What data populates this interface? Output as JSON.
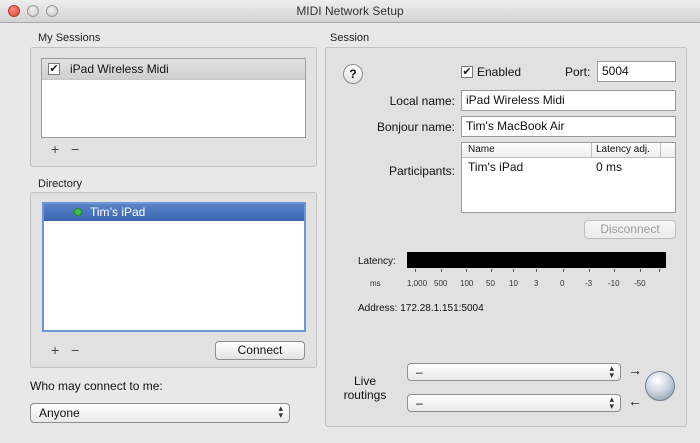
{
  "window": {
    "title": "MIDI Network Setup"
  },
  "my_sessions": {
    "label": "My Sessions",
    "items": [
      {
        "label": "iPad Wireless Midi",
        "checked": true,
        "mark": "✔"
      }
    ],
    "add": "+",
    "remove": "−"
  },
  "directory": {
    "label": "Directory",
    "items": [
      {
        "label": "Tim’s iPad",
        "status_color": "#3cc43c"
      }
    ],
    "add": "+",
    "remove": "−",
    "connect_label": "Connect"
  },
  "who_connect": {
    "label": "Who may connect to me:",
    "value": "Anyone"
  },
  "session": {
    "label": "Session",
    "help": "?",
    "enabled_label": "Enabled",
    "enabled_mark": "✔",
    "port_label": "Port:",
    "port_value": "5004",
    "local_name_label": "Local name:",
    "local_name_value": "iPad Wireless Midi",
    "bonjour_label": "Bonjour name:",
    "bonjour_value": "Tim's MacBook Air",
    "participants_label": "Participants:",
    "participants_headers": {
      "name": "Name",
      "latency": "Latency adj."
    },
    "participants": [
      {
        "name": "Tim's iPad",
        "latency": "0 ms"
      }
    ],
    "disconnect_label": "Disconnect",
    "latency_label": "Latency:",
    "latency_scale": {
      "unit": "ms",
      "values": [
        "1,000",
        "500",
        "100",
        "50",
        "10",
        "3",
        "0",
        "-3",
        "-10",
        "-50"
      ]
    },
    "address": "Address: 172.28.1.151:5004",
    "live_routings_label_1": "Live",
    "live_routings_label_2": "routings",
    "routing_in": "–",
    "routing_out": "–",
    "arrow_right": "→",
    "arrow_left": "←"
  },
  "colors": {
    "selection_blue": "#3b66b2",
    "status_green": "#3cc43c"
  }
}
